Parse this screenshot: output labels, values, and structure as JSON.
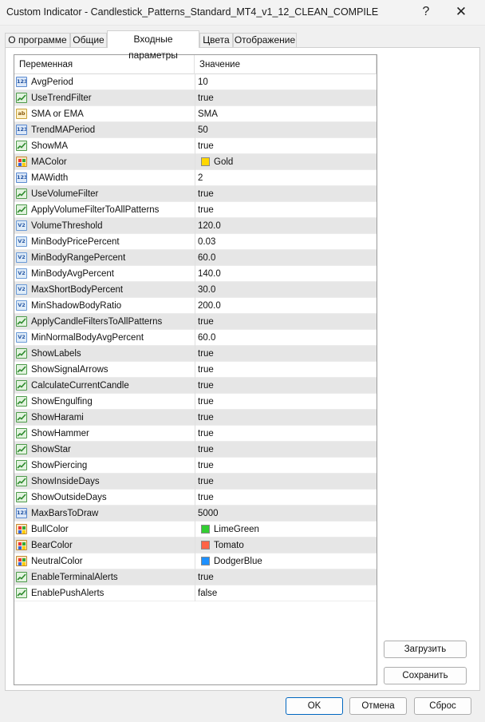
{
  "window": {
    "title": "Custom Indicator - Candlestick_Patterns_Standard_MT4_v1_12_CLEAN_COMPILE",
    "help_glyph": "?",
    "close_glyph": "✕"
  },
  "tabs": [
    {
      "label": "О программе",
      "active": false
    },
    {
      "label": "Общие",
      "active": false
    },
    {
      "label": "Входные параметры",
      "active": true
    },
    {
      "label": "Цвета",
      "active": false
    },
    {
      "label": "Отображение",
      "active": false
    }
  ],
  "grid": {
    "header": {
      "name": "Переменная",
      "value": "Значение"
    },
    "rows": [
      {
        "type": "int",
        "name": "AvgPeriod",
        "value": "10"
      },
      {
        "type": "bool",
        "name": "UseTrendFilter",
        "value": "true"
      },
      {
        "type": "string",
        "name": "SMA or EMA",
        "value": "SMA"
      },
      {
        "type": "int",
        "name": "TrendMAPeriod",
        "value": "50"
      },
      {
        "type": "bool",
        "name": "ShowMA",
        "value": "true"
      },
      {
        "type": "color",
        "name": "MAColor",
        "value": "Gold",
        "swatch": "#FFD700"
      },
      {
        "type": "int",
        "name": "MAWidth",
        "value": "2"
      },
      {
        "type": "bool",
        "name": "UseVolumeFilter",
        "value": "true"
      },
      {
        "type": "bool",
        "name": "ApplyVolumeFilterToAllPatterns",
        "value": "true"
      },
      {
        "type": "double",
        "name": "VolumeThreshold",
        "value": "120.0"
      },
      {
        "type": "double",
        "name": "MinBodyPricePercent",
        "value": "0.03"
      },
      {
        "type": "double",
        "name": "MinBodyRangePercent",
        "value": "60.0"
      },
      {
        "type": "double",
        "name": "MinBodyAvgPercent",
        "value": "140.0"
      },
      {
        "type": "double",
        "name": "MaxShortBodyPercent",
        "value": "30.0"
      },
      {
        "type": "double",
        "name": "MinShadowBodyRatio",
        "value": "200.0"
      },
      {
        "type": "bool",
        "name": "ApplyCandleFiltersToAllPatterns",
        "value": "true"
      },
      {
        "type": "double",
        "name": "MinNormalBodyAvgPercent",
        "value": "60.0"
      },
      {
        "type": "bool",
        "name": "ShowLabels",
        "value": "true"
      },
      {
        "type": "bool",
        "name": "ShowSignalArrows",
        "value": "true"
      },
      {
        "type": "bool",
        "name": "CalculateCurrentCandle",
        "value": "true"
      },
      {
        "type": "bool",
        "name": "ShowEngulfing",
        "value": "true"
      },
      {
        "type": "bool",
        "name": "ShowHarami",
        "value": "true"
      },
      {
        "type": "bool",
        "name": "ShowHammer",
        "value": "true"
      },
      {
        "type": "bool",
        "name": "ShowStar",
        "value": "true"
      },
      {
        "type": "bool",
        "name": "ShowPiercing",
        "value": "true"
      },
      {
        "type": "bool",
        "name": "ShowInsideDays",
        "value": "true"
      },
      {
        "type": "bool",
        "name": "ShowOutsideDays",
        "value": "true"
      },
      {
        "type": "int",
        "name": "MaxBarsToDraw",
        "value": "5000"
      },
      {
        "type": "color",
        "name": "BullColor",
        "value": "LimeGreen",
        "swatch": "#32CD32"
      },
      {
        "type": "color",
        "name": "BearColor",
        "value": "Tomato",
        "swatch": "#FF6347"
      },
      {
        "type": "color",
        "name": "NeutralColor",
        "value": "DodgerBlue",
        "swatch": "#1E90FF"
      },
      {
        "type": "bool",
        "name": "EnableTerminalAlerts",
        "value": "true"
      },
      {
        "type": "bool",
        "name": "EnablePushAlerts",
        "value": "false"
      }
    ]
  },
  "icons": {
    "int": "123",
    "double": "V2",
    "string": "ab"
  },
  "buttons": {
    "load": "Загрузить",
    "save": "Сохранить",
    "ok": "OK",
    "cancel": "Отмена",
    "reset": "Сброс"
  },
  "colors": {
    "accent": "#0067c0"
  }
}
